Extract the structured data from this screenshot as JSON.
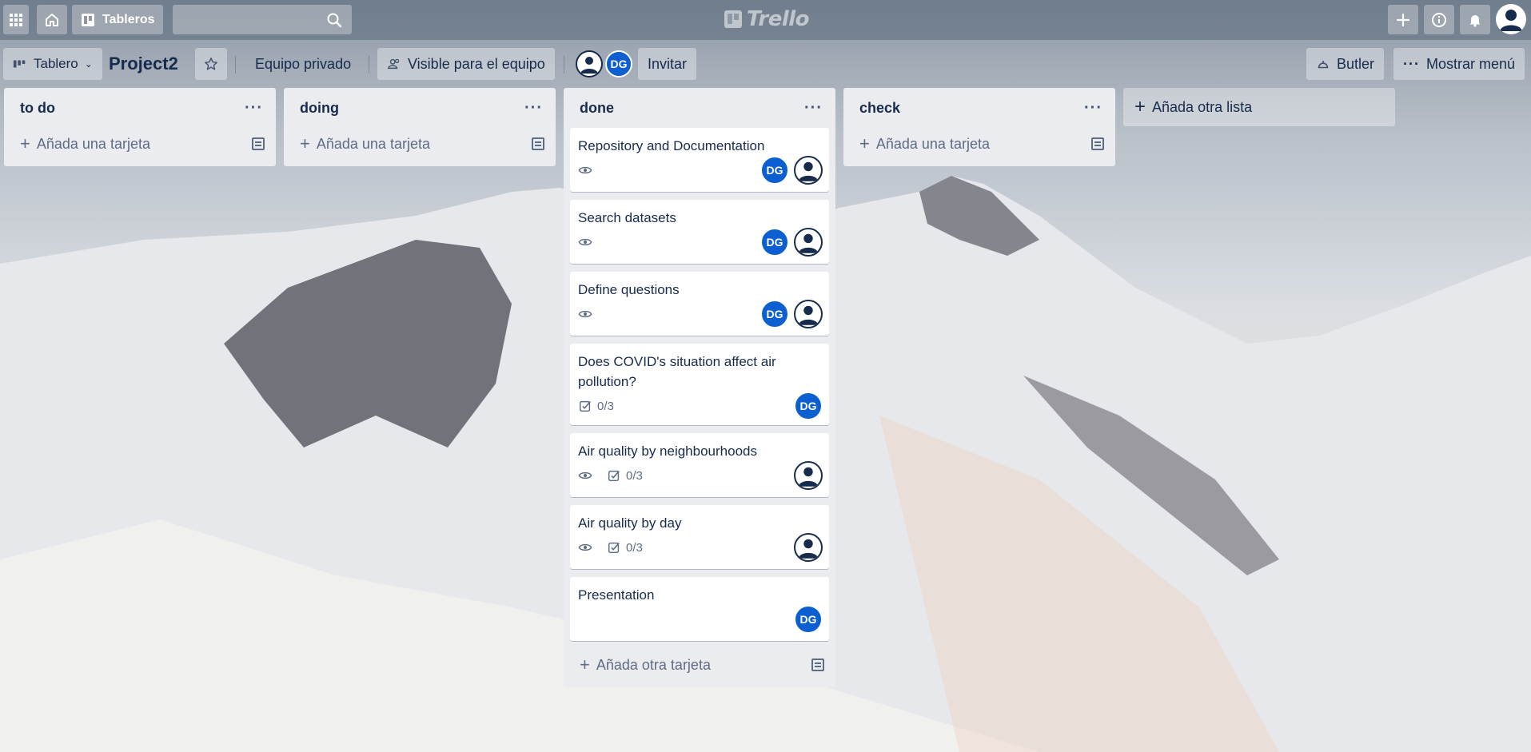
{
  "header": {
    "boards_label": "Tableros",
    "search_placeholder": "",
    "logo_text": "Trello"
  },
  "board": {
    "view_label": "Tablero",
    "title": "Project2",
    "team_label": "Equipo privado",
    "visibility_label": "Visible para el equipo",
    "member_initials": "DG",
    "invite_label": "Invitar",
    "butler_label": "Butler",
    "menu_label": "Mostrar menú"
  },
  "lists": [
    {
      "title": "to do",
      "add_label": "Añada una tarjeta",
      "cards": []
    },
    {
      "title": "doing",
      "add_label": "Añada una tarjeta",
      "cards": []
    },
    {
      "title": "done",
      "add_label": "Añada otra tarjeta",
      "cards": [
        {
          "title": "Repository and Documentation",
          "watch": true,
          "checklist": "",
          "members": [
            "DG",
            "user"
          ]
        },
        {
          "title": "Search datasets",
          "watch": true,
          "checklist": "",
          "members": [
            "DG",
            "user"
          ]
        },
        {
          "title": "Define questions",
          "watch": true,
          "checklist": "",
          "members": [
            "DG",
            "user"
          ]
        },
        {
          "title": "Does COVID's situation affect air pollution?",
          "watch": false,
          "checklist": "0/3",
          "members": [
            "DG"
          ]
        },
        {
          "title": "Air quality by neighbourhoods",
          "watch": true,
          "checklist": "0/3",
          "members": [
            "user"
          ]
        },
        {
          "title": "Air quality by day",
          "watch": true,
          "checklist": "0/3",
          "members": [
            "user"
          ]
        },
        {
          "title": "Presentation",
          "watch": false,
          "checklist": "",
          "members": [
            "DG"
          ]
        }
      ]
    },
    {
      "title": "check",
      "add_label": "Añada una tarjeta",
      "cards": []
    }
  ],
  "add_list_label": "Añada otra lista",
  "colors": {
    "avatar_blue": "#0b5fd0",
    "list_bg": "#ebecf0"
  },
  "icons": [
    "apps-grid-icon",
    "home-icon",
    "board-icon",
    "search-icon",
    "plus-icon",
    "info-icon",
    "bell-icon",
    "user-avatar-icon",
    "star-icon",
    "team-icon",
    "butler-icon",
    "more-icon",
    "eye-icon",
    "checklist-icon",
    "template-icon"
  ]
}
